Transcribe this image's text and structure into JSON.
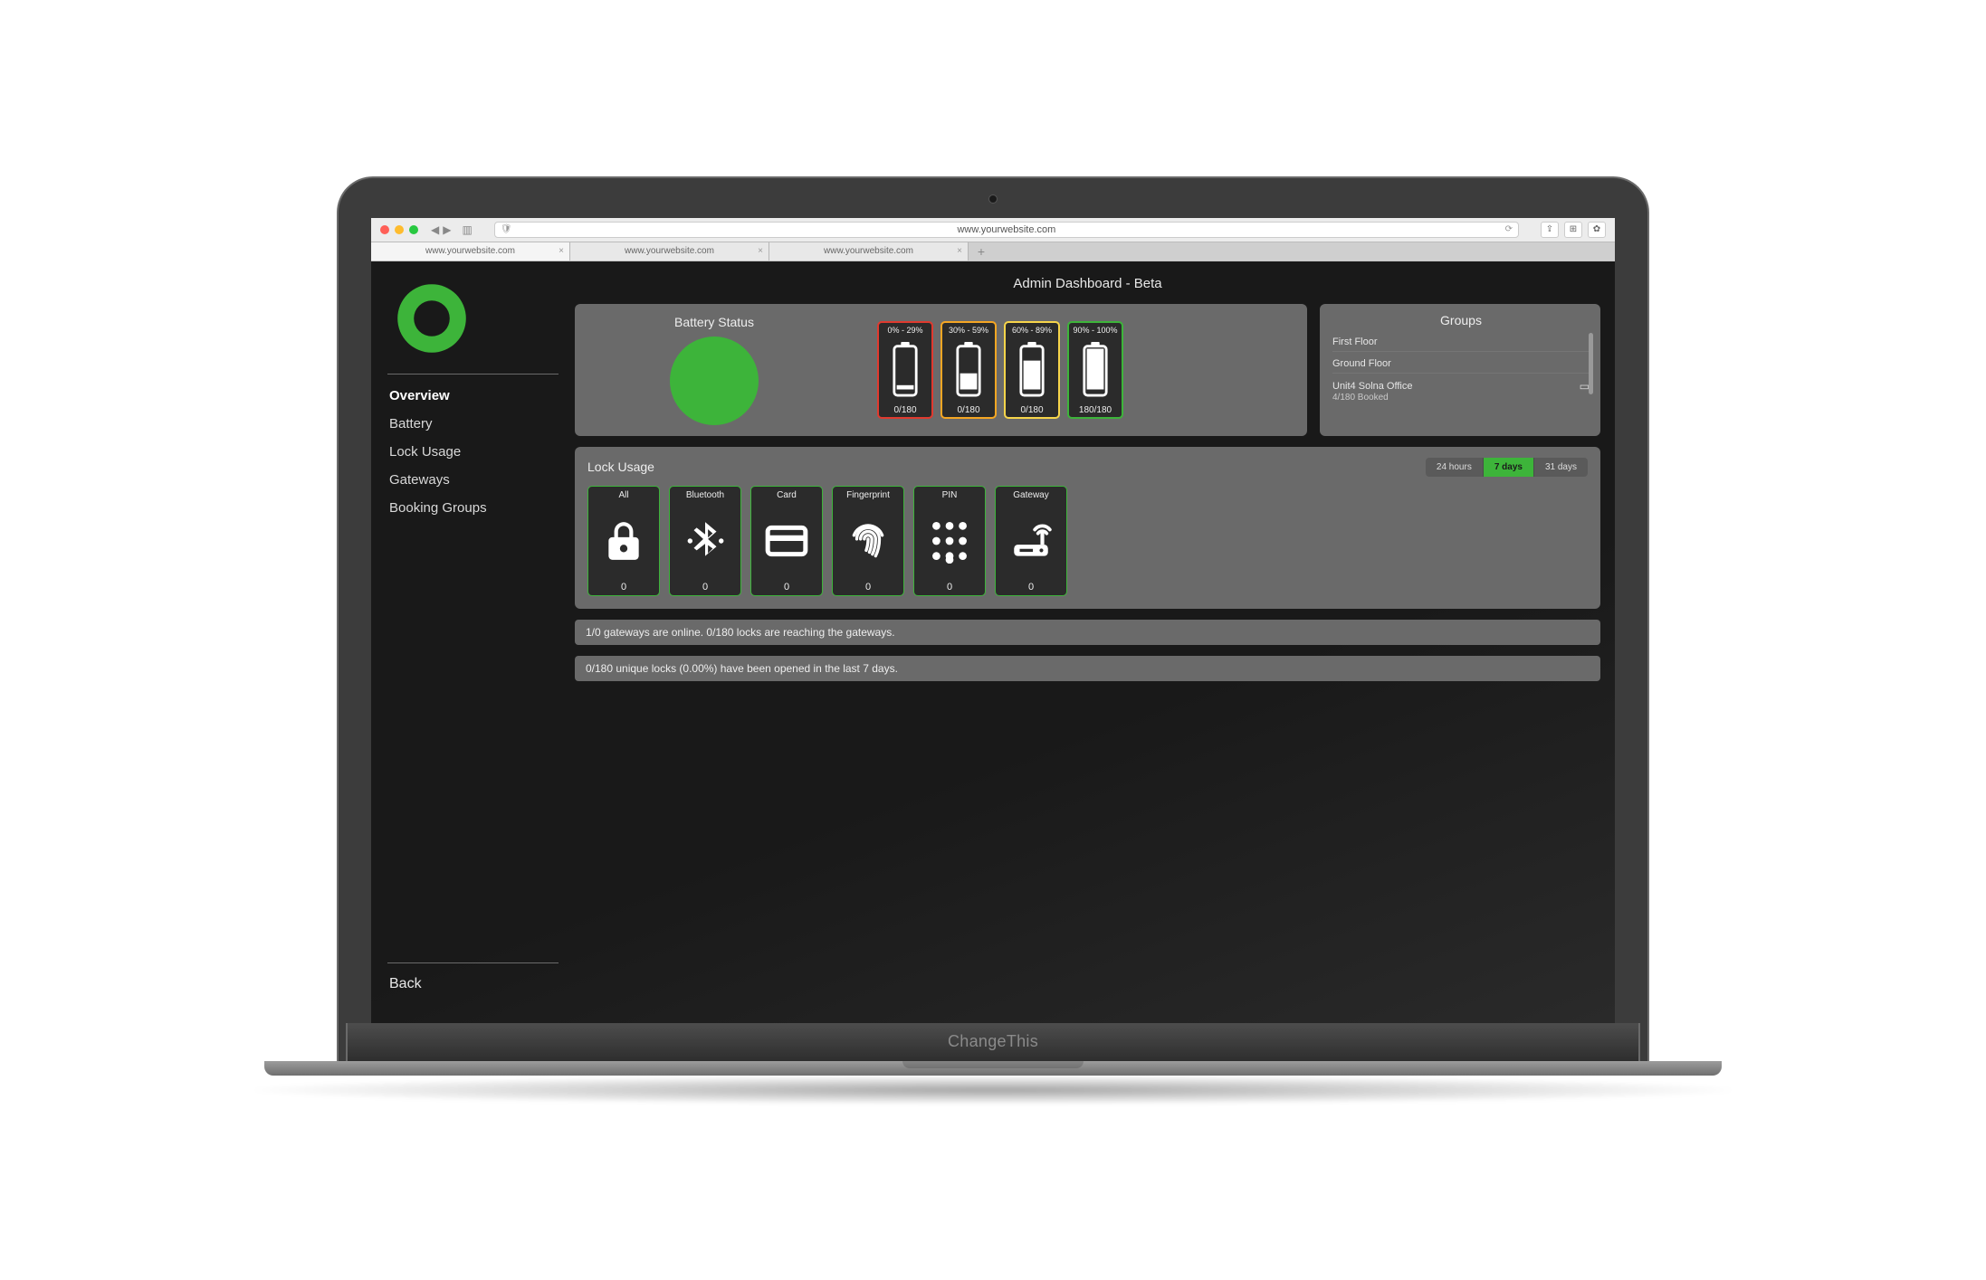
{
  "device_brand": "ChangeThis",
  "browser": {
    "url": "www.yourwebsite.com",
    "tabs": [
      "www.yourwebsite.com",
      "www.yourwebsite.com",
      "www.yourwebsite.com"
    ]
  },
  "page_title": "Admin Dashboard - Beta",
  "sidebar": {
    "items": [
      "Overview",
      "Battery",
      "Lock Usage",
      "Gateways",
      "Booking Groups"
    ],
    "active_index": 0,
    "back_label": "Back"
  },
  "battery": {
    "title": "Battery Status",
    "ranges": [
      {
        "range": "0% - 29%",
        "count": "0/180",
        "fill": 0.1,
        "color": "red"
      },
      {
        "range": "30% - 59%",
        "count": "0/180",
        "fill": 0.4,
        "color": "orange"
      },
      {
        "range": "60% - 89%",
        "count": "0/180",
        "fill": 0.7,
        "color": "yellow"
      },
      {
        "range": "90% - 100%",
        "count": "180/180",
        "fill": 1.0,
        "color": "green"
      }
    ]
  },
  "groups": {
    "title": "Groups",
    "items": [
      {
        "name": "First Floor"
      },
      {
        "name": "Ground Floor"
      },
      {
        "name": "Unit4 Solna Office",
        "sub": "4/180 Booked",
        "icon": true
      }
    ]
  },
  "lock_usage": {
    "title": "Lock Usage",
    "ranges": [
      "24 hours",
      "7 days",
      "31 days"
    ],
    "active_range": 1,
    "types": [
      {
        "label": "All",
        "icon": "lock",
        "count": 0
      },
      {
        "label": "Bluetooth",
        "icon": "bluetooth",
        "count": 0
      },
      {
        "label": "Card",
        "icon": "card",
        "count": 0
      },
      {
        "label": "Fingerprint",
        "icon": "fingerprint",
        "count": 0
      },
      {
        "label": "PIN",
        "icon": "keypad",
        "count": 0
      },
      {
        "label": "Gateway",
        "icon": "router",
        "count": 0
      }
    ]
  },
  "status_bars": [
    "1/0 gateways are online. 0/180 locks are reaching the gateways.",
    "0/180 unique locks (0.00%) have been opened in the last 7 days."
  ]
}
